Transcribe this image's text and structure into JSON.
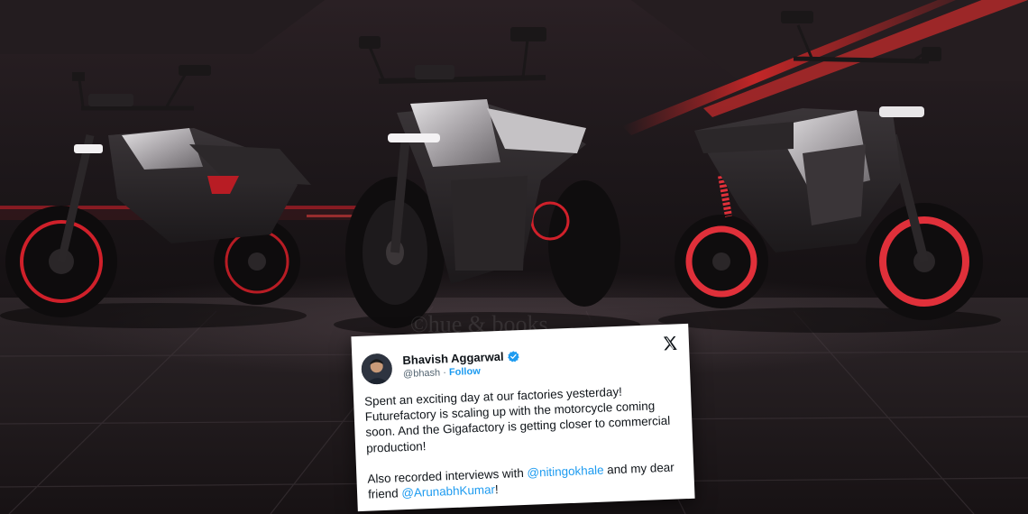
{
  "tweet": {
    "author_name": "Bhavish Aggarwal",
    "handle": "@bhash",
    "separator": "·",
    "follow_label": "Follow",
    "paragraph1": "Spent an exciting day at our factories yesterday! Futurefactory is scaling up with the motorcycle coming soon. And the Gigafactory is getting closer to commercial production!",
    "paragraph2_prefix": "Also recorded interviews with ",
    "mention1": "@nitingokhale",
    "paragraph2_middle": " and my dear friend ",
    "mention2": "@ArunabhKumar",
    "paragraph2_suffix": "!"
  },
  "watermark": "©hue & books",
  "colors": {
    "link": "#1d9bf0",
    "accent_red": "#d0202a",
    "background": "#1a1416"
  },
  "icons": {
    "verified": "verified-badge-icon",
    "platform": "x-logo-icon"
  }
}
